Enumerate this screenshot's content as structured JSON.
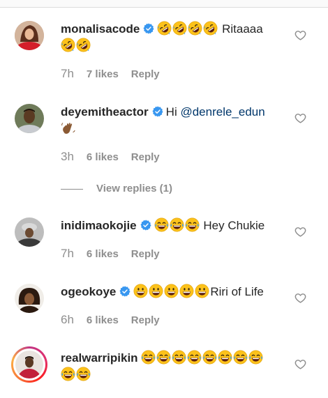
{
  "comments": [
    {
      "username": "monalisacode",
      "verified": true,
      "text": "Ritaaaa",
      "emojis_before": [
        "face-with-tears-of-joy-rolling",
        "face-with-tears-of-joy-rolling",
        "face-with-tears-of-joy-rolling",
        "face-with-tears-of-joy-rolling"
      ],
      "emojis_after": [
        "face-with-tears-of-joy-rolling",
        "face-with-tears-of-joy-rolling"
      ],
      "time": "7h",
      "likes": "7 likes",
      "reply": "Reply"
    },
    {
      "username": "deyemitheactor",
      "verified": true,
      "text_prefix": "Hi",
      "mention": "@denrele_edun",
      "emojis_after": [
        "waving-hand"
      ],
      "time": "3h",
      "likes": "6 likes",
      "reply": "Reply",
      "view_replies": "View replies (1)"
    },
    {
      "username": "inidimaokojie",
      "verified": true,
      "emojis_before": [
        "face-with-tears-of-joy",
        "face-with-tears-of-joy",
        "face-with-tears-of-joy"
      ],
      "text": "Hey Chukie",
      "time": "7h",
      "likes": "6 likes",
      "reply": "Reply"
    },
    {
      "username": "ogeokoye",
      "verified": true,
      "emojis_before": [
        "grinning-face",
        "grinning-face",
        "grinning-face",
        "grinning-face",
        "grinning-face"
      ],
      "text": "Riri of Life",
      "time": "6h",
      "likes": "6 likes",
      "reply": "Reply"
    },
    {
      "username": "realwarripikin",
      "verified": false,
      "emojis_before": [
        "face-with-tears-of-joy",
        "face-with-tears-of-joy",
        "face-with-tears-of-joy",
        "face-with-tears-of-joy",
        "face-with-tears-of-joy",
        "face-with-tears-of-joy",
        "face-with-tears-of-joy",
        "face-with-tears-of-joy",
        "face-with-tears-of-joy",
        "face-with-tears-of-joy"
      ]
    }
  ],
  "icons": {
    "like": "heart-outline-icon",
    "verified": "verified-badge-icon"
  },
  "colors": {
    "verified": "#3897f0",
    "meta": "#8e8e8e",
    "mention": "#00376b",
    "emoji": "#fcc21b"
  }
}
